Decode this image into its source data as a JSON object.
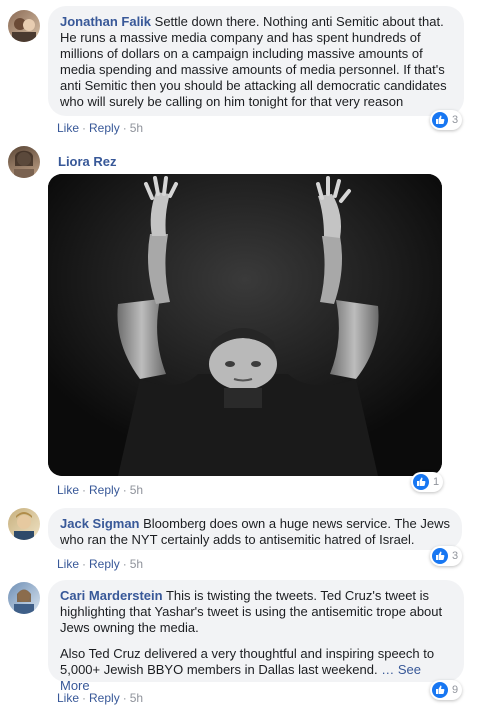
{
  "comments": [
    {
      "author": "Jonathan Falik",
      "text": "Settle down there. Nothing anti Semitic about that. He runs a massive media company and has spent hundreds of millions of dollars on a campaign including massive amounts of media spending and massive amounts of media personnel. If that's anti Semitic then you should be attacking all democratic candidates who will surely be calling on him tonight for that very reason",
      "like_label": "Like",
      "reply_label": "Reply",
      "time": "5h",
      "reactions": "3"
    },
    {
      "author": "Liora Rez",
      "like_label": "Like",
      "reply_label": "Reply",
      "time": "5h",
      "reactions": "1"
    },
    {
      "author": "Jack Sigman",
      "text": "Bloomberg does own a huge news service. The Jews who ran the NYT certainly adds to antisemitic hatred of Israel.",
      "like_label": "Like",
      "reply_label": "Reply",
      "time": "5h",
      "reactions": "3"
    },
    {
      "author": "Cari Marderstein",
      "text": "This is twisting the tweets. Ted Cruz's tweet is highlighting that Yashar's tweet is using the antisemitic trope about Jews owning the media.",
      "text2": "Also Ted Cruz delivered a very thoughtful and inspiring speech to 5,000+ Jewish BBYO members in Dallas last weekend.",
      "ellipsis": "…",
      "see_more": "See More",
      "like_label": "Like",
      "reply_label": "Reply",
      "time": "5h",
      "reactions": "9"
    }
  ],
  "separator": "·",
  "colors": {
    "link": "#385898",
    "bubble": "#f2f3f5",
    "like_blue": "#1877f2",
    "meta_gray": "#90949c"
  },
  "icons": {
    "reaction": "thumbs-up-icon"
  }
}
